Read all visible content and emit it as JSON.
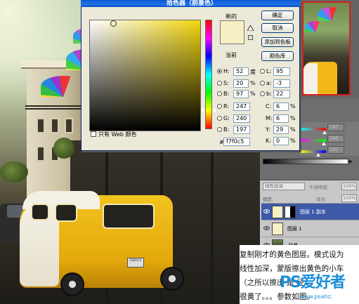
{
  "dialog": {
    "title": "拾色器（前景色）",
    "new_label": "新的",
    "current_label": "当前",
    "new_color": "#f7f0c5",
    "buttons": {
      "ok": "确定",
      "cancel": "取消",
      "add_swatches": "添加到色板",
      "color_libraries": "颜色库"
    },
    "web_only_label": "只有 Web 颜色",
    "hsb": {
      "h_label": "H:",
      "h_value": "52",
      "h_unit": "度",
      "s_label": "S:",
      "s_value": "20",
      "s_unit": "%",
      "b_label": "B:",
      "b_value": "97",
      "b_unit": "%"
    },
    "lab": {
      "l_label": "L:",
      "l_value": "95",
      "a_label": "a:",
      "a_value": "-3",
      "b_label": "b:",
      "b_value": "22"
    },
    "rgb": {
      "r_label": "R:",
      "r_value": "247",
      "g_label": "G:",
      "g_value": "240",
      "b_label": "B:",
      "b_value": "197"
    },
    "cmyk": {
      "c_label": "C:",
      "c_value": "6",
      "c_unit": "%",
      "m_label": "M:",
      "m_value": "6",
      "m_unit": "%",
      "y_label": "Y:",
      "y_value": "29",
      "y_unit": "%",
      "k_label": "K:",
      "k_value": "0",
      "k_unit": "%"
    },
    "hex_label": "#",
    "hex_value": "f7f0c5"
  },
  "adjust_panel": {
    "values": [
      "247",
      "240",
      "197"
    ]
  },
  "layers": {
    "blend_mode": "线性加深",
    "opacity_label": "不透明度:",
    "opacity_value": "100%",
    "lock_label": "锁定:",
    "fill_label": "填充:",
    "fill_value": "100%",
    "items": [
      {
        "name": "图层 1 副本",
        "selected": true
      },
      {
        "name": "图层 1",
        "selected": false
      },
      {
        "name": "背景",
        "selected": false
      }
    ]
  },
  "caption": {
    "lines": [
      "复制刚才的黄色图层。模式设为",
      "线性加深，蒙版擦出黄色的小车",
      "（之所以擦出 是                  经",
      "很黄了。。。参数如图。"
    ]
  },
  "photo": {
    "plate_text": "F&B%75"
  },
  "watermark": {
    "brand": "PS爱好者",
    "url": "www.psahz."
  }
}
